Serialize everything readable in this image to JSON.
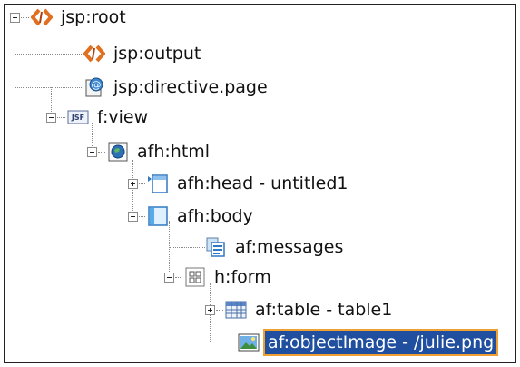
{
  "tree": {
    "nodes": [
      {
        "label": "jsp:root",
        "icon": "xml-tag-icon",
        "expander": "expanded"
      },
      {
        "label": "jsp:output",
        "icon": "xml-tag-icon",
        "expander": ""
      },
      {
        "label": "jsp:directive.page",
        "icon": "directive-icon",
        "expander": ""
      },
      {
        "label": "f:view",
        "icon": "jsf-icon",
        "expander": "expanded"
      },
      {
        "label": "afh:html",
        "icon": "globe-icon",
        "expander": "expanded"
      },
      {
        "label": "afh:head - untitled1",
        "icon": "head-icon",
        "expander": "collapsed"
      },
      {
        "label": "afh:body",
        "icon": "body-icon",
        "expander": "expanded"
      },
      {
        "label": "af:messages",
        "icon": "messages-icon",
        "expander": ""
      },
      {
        "label": "h:form",
        "icon": "form-icon",
        "expander": "expanded"
      },
      {
        "label": "af:table - table1",
        "icon": "table-icon",
        "expander": "collapsed"
      },
      {
        "label": "af:objectImage - /julie.png",
        "icon": "image-icon",
        "expander": "",
        "selected": true
      }
    ]
  },
  "colors": {
    "selection": "#1f4f9e",
    "selection_border": "#f0a030"
  }
}
